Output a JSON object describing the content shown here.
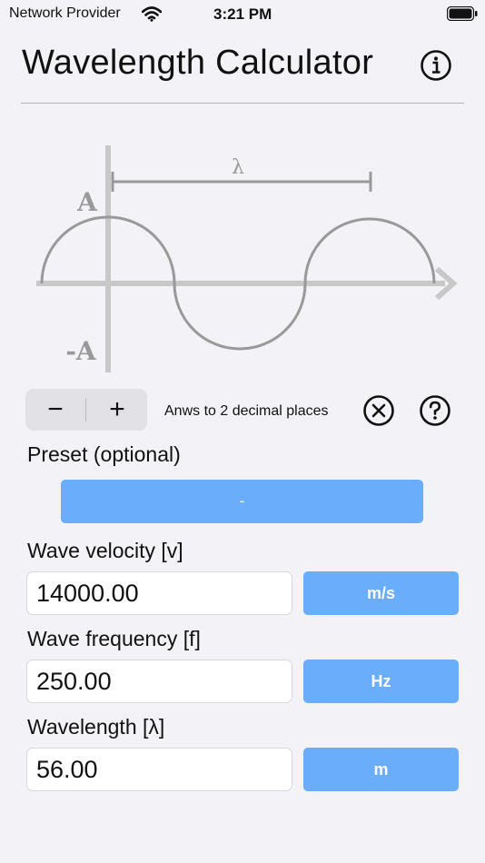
{
  "status_bar": {
    "carrier": "Network Provider",
    "time": "3:21 PM"
  },
  "header": {
    "title": "Wavelength Calculator",
    "info_icon": "info-circle-icon"
  },
  "diagram": {
    "lambda_label": "λ",
    "amplitude_label": "A",
    "neg_amplitude_label": "-A"
  },
  "controls": {
    "minus_symbol": "−",
    "plus_symbol": "+",
    "decimal_label": "Anws to 2 decimal places",
    "clear_icon": "clear-circle-x-icon",
    "help_icon": "help-circle-question-icon"
  },
  "preset": {
    "label": "Preset (optional)",
    "value": "-"
  },
  "velocity": {
    "label": "Wave velocity [v]",
    "value": "14000.00",
    "unit": "m/s"
  },
  "frequency": {
    "label": "Wave frequency [f]",
    "value": "250.00",
    "unit": "Hz"
  },
  "wavelength": {
    "label": "Wavelength [λ]",
    "value": "56.00",
    "unit": "m"
  },
  "colors": {
    "accent_button": "#6aadfa",
    "background": "#f2f2f7",
    "diagram_gray": "#999999"
  }
}
